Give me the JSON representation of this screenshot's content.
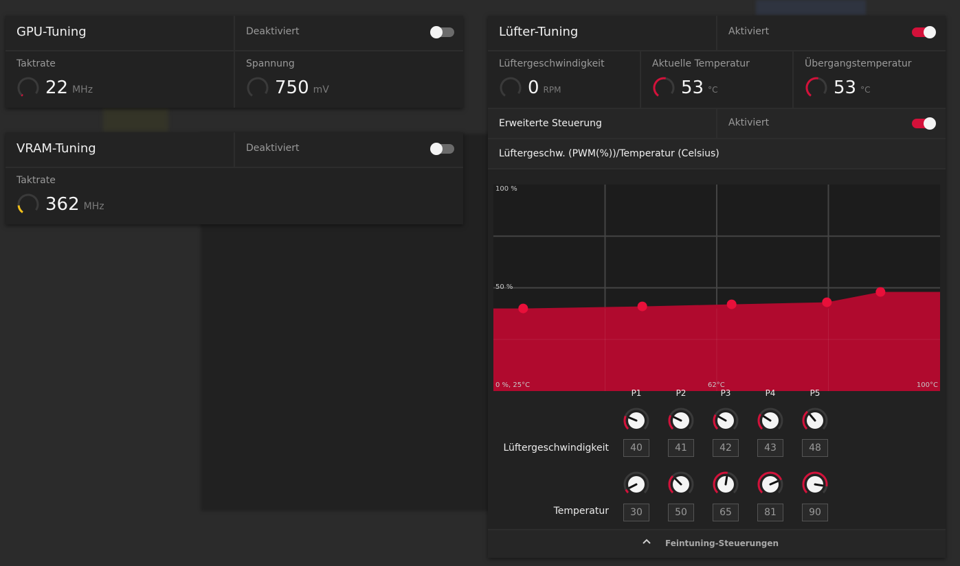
{
  "gpu_tuning": {
    "title": "GPU-Tuning",
    "state": "Deaktiviert",
    "clock": {
      "label": "Taktrate",
      "value": "22",
      "unit": "MHz"
    },
    "voltage": {
      "label": "Spannung",
      "value": "750",
      "unit": "mV"
    }
  },
  "vram_tuning": {
    "title": "VRAM-Tuning",
    "state": "Deaktiviert",
    "clock": {
      "label": "Taktrate",
      "value": "362",
      "unit": "MHz"
    }
  },
  "fan_tuning": {
    "title": "Lüfter-Tuning",
    "state": "Aktiviert",
    "fan_speed": {
      "label": "Lüftergeschwindigkeit",
      "value": "0",
      "unit": "RPM"
    },
    "current_temp": {
      "label": "Aktuelle Temperatur",
      "value": "53",
      "unit": "°C"
    },
    "junction_temp": {
      "label": "Übergangstemperatur",
      "value": "53",
      "unit": "°C"
    },
    "advanced": {
      "label": "Erweiterte Steuerung",
      "state": "Aktiviert"
    },
    "curve_title": "Lüftergeschw. (PWM(%))/Temperatur (Celsius)",
    "footer": "Feintuning-Steuerungen"
  },
  "chart_data": {
    "type": "area",
    "title": "Lüftergeschw. (PWM(%))/Temperatur (Celsius)",
    "x_labels": [
      "0 %, 25°C",
      "62°C",
      "100°C"
    ],
    "y_labels": [
      "100 %",
      "50 %"
    ],
    "xlim": [
      25,
      100
    ],
    "ylim": [
      0,
      100
    ],
    "points": [
      {
        "name": "P1",
        "temp": 30,
        "speed": 40
      },
      {
        "name": "P2",
        "temp": 50,
        "speed": 41
      },
      {
        "name": "P3",
        "temp": 65,
        "speed": 42
      },
      {
        "name": "P4",
        "temp": 81,
        "speed": 43
      },
      {
        "name": "P5",
        "temp": 90,
        "speed": 48
      }
    ],
    "fill_color": "#b00a2e",
    "point_color": "#e8103a"
  },
  "controls": {
    "speed_label": "Lüftergeschwindigkeit",
    "temp_label": "Temperatur",
    "points": [
      "P1",
      "P2",
      "P3",
      "P4",
      "P5"
    ],
    "speeds": [
      "40",
      "41",
      "42",
      "43",
      "48"
    ],
    "temps": [
      "30",
      "50",
      "65",
      "81",
      "90"
    ]
  },
  "colors": {
    "accent": "#d3113a",
    "gauge_yellow": "#f2c01a"
  }
}
